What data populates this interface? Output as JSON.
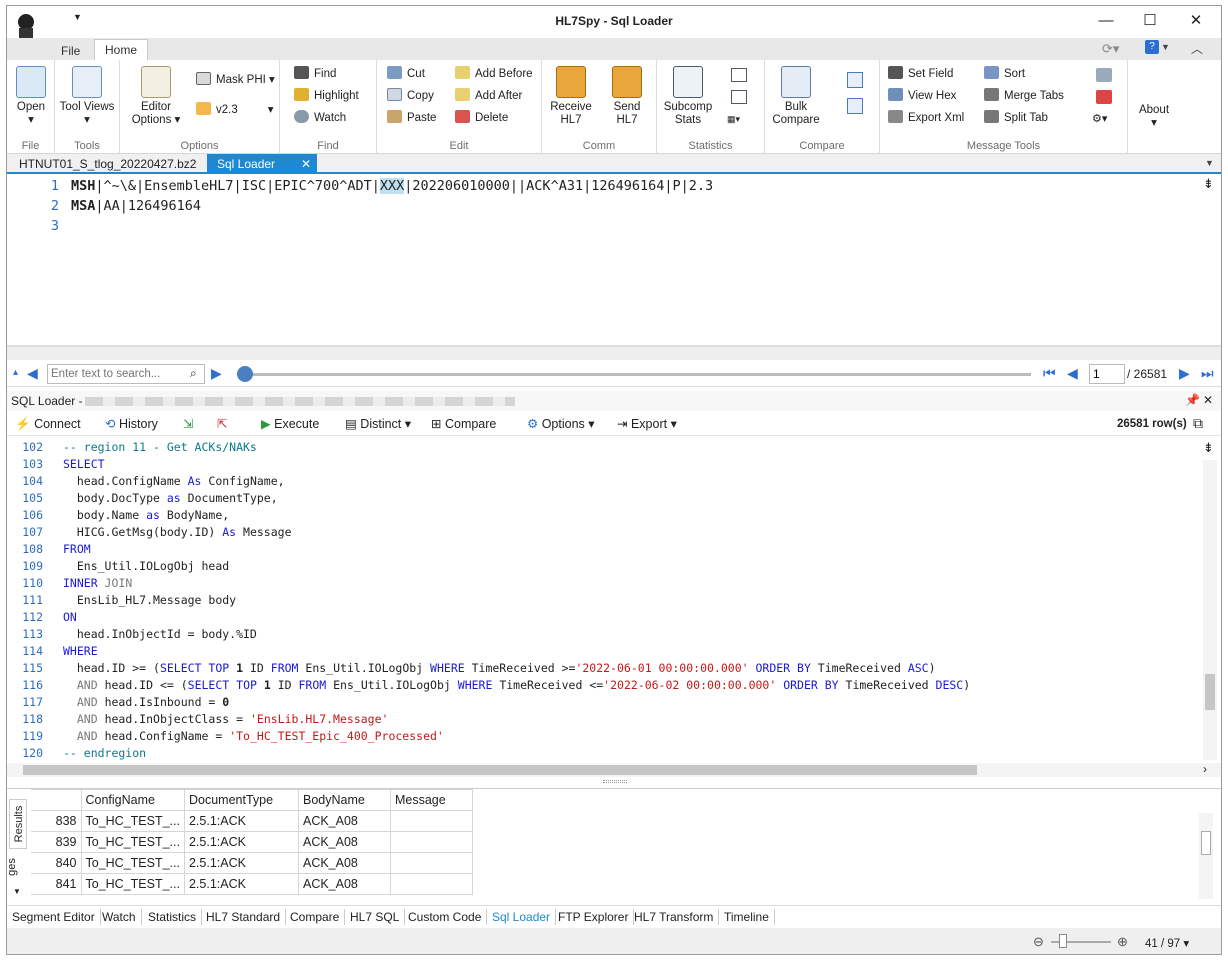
{
  "app": {
    "title": "HL7Spy - Sql Loader"
  },
  "ribbon_tabs": [
    {
      "label": "File"
    },
    {
      "label": "Home"
    }
  ],
  "groups": {
    "file": "File",
    "tools": "Tools",
    "options": "Options",
    "find": "Find",
    "edit": "Edit",
    "comm": "Comm",
    "statistics": "Statistics",
    "compare": "Compare",
    "message_tools": "Message Tools"
  },
  "buttons": {
    "open": "Open",
    "tool_views": "Tool Views",
    "editor_options": "Editor Options",
    "mask_phi": "Mask PHI",
    "version": "v2.3",
    "find": "Find",
    "highlight": "Highlight",
    "watch": "Watch",
    "cut": "Cut",
    "copy": "Copy",
    "paste": "Paste",
    "add_before": "Add Before",
    "add_after": "Add After",
    "delete": "Delete",
    "receive": "Receive HL7",
    "send": "Send HL7",
    "subcomp": "Subcomp Stats",
    "bulk": "Bulk Compare",
    "set_field": "Set Field",
    "view_hex": "View Hex",
    "export_xml": "Export Xml",
    "sort": "Sort",
    "merge_tabs": "Merge Tabs",
    "split_tab": "Split Tab",
    "about": "About"
  },
  "doc_tabs": [
    {
      "label": "HTNUT01_S_tlog_20220427.bz2"
    },
    {
      "label": "Sql Loader"
    }
  ],
  "hl7": {
    "l1a": "MSH",
    "l1b": "|^~\\&|EnsembleHL7|ISC|EPIC^700^ADT|",
    "l1c": "XXX",
    "l1d": "|202206010000||ACK^A31|126496164|P|2.3",
    "l2a": "MSA",
    "l2b": "|AA|126496164"
  },
  "nav": {
    "search_placeholder": "Enter text to search...",
    "page": "1",
    "total": "/ 26581"
  },
  "sql_panel": {
    "title": "SQL Loader -",
    "connect": "Connect",
    "history": "History",
    "execute": "Execute",
    "distinct": "Distinct",
    "compare": "Compare",
    "options": "Options",
    "export": "Export",
    "row_count": "26581 row(s)"
  },
  "sql": {
    "c102": "-- region 11 - Get ACKs/NAKs",
    "c103": "SELECT",
    "c104a": "  head.ConfigName ",
    "as": "As",
    "c104b": " ConfigName,",
    "c105a": "  body.DocType ",
    "as2": "as",
    "c105b": " DocumentType,",
    "c106a": "  body.Name ",
    "c106b": " BodyName,",
    "c107a": "  HICG.GetMsg(body.ID) ",
    "c107b": " Message",
    "from": "FROM",
    "c109": "  Ens_Util.IOLogObj head",
    "inner": "INNER",
    "join": " JOIN",
    "c111": "  EnsLib_HL7.Message body",
    "on": "ON",
    "c113": "  head.InObjectId = body.%ID",
    "where": "WHERE",
    "c115a": "  head.ID >= (",
    "select": "SELECT",
    "top": "TOP",
    "one": "1",
    "c115b": " ID ",
    "c115c": " Ens_Util.IOLogObj ",
    "c115d": " TimeReceived >=",
    "d1": "'2022-06-01 00:00:00.000'",
    "order": "ORDER BY",
    "c115e": " TimeReceived ",
    "asc": "ASC",
    "and": "AND",
    "c116a": " head.ID <= (",
    "c116d": " TimeReceived <=",
    "d2": "'2022-06-02 00:00:00.000'",
    "desc": "DESC",
    "c117": " head.IsInbound = ",
    "zero": "0",
    "c118": " head.InObjectClass = ",
    "s118": "'EnsLib.HL7.Message'",
    "c119": " head.ConfigName = ",
    "s119": "'To_HC_TEST_Epic_400_Processed'",
    "c120": "-- endregion"
  },
  "sql_lines": [
    "102",
    "103",
    "104",
    "105",
    "106",
    "107",
    "108",
    "109",
    "110",
    "111",
    "112",
    "113",
    "114",
    "115",
    "116",
    "117",
    "118",
    "119",
    "120"
  ],
  "results": {
    "headers": [
      "ConfigName",
      "DocumentType",
      "BodyName",
      "Message"
    ],
    "rows": [
      [
        "838",
        "To_HC_TEST_...",
        "2.5.1:ACK",
        "ACK_A08",
        ""
      ],
      [
        "839",
        "To_HC_TEST_...",
        "2.5.1:ACK",
        "ACK_A08",
        ""
      ],
      [
        "840",
        "To_HC_TEST_...",
        "2.5.1:ACK",
        "ACK_A08",
        ""
      ],
      [
        "841",
        "To_HC_TEST_...",
        "2.5.1:ACK",
        "ACK_A08",
        ""
      ]
    ],
    "side_tab": "Results",
    "side_tab2": "ges"
  },
  "bottom_tabs": [
    "Segment Editor",
    "Watch",
    "Statistics",
    "HL7 Standard",
    "Compare",
    "HL7 SQL",
    "Custom Code",
    "Sql Loader",
    "FTP Explorer",
    "HL7 Transform",
    "Timeline"
  ],
  "status": {
    "zoom": "41 / 97"
  }
}
